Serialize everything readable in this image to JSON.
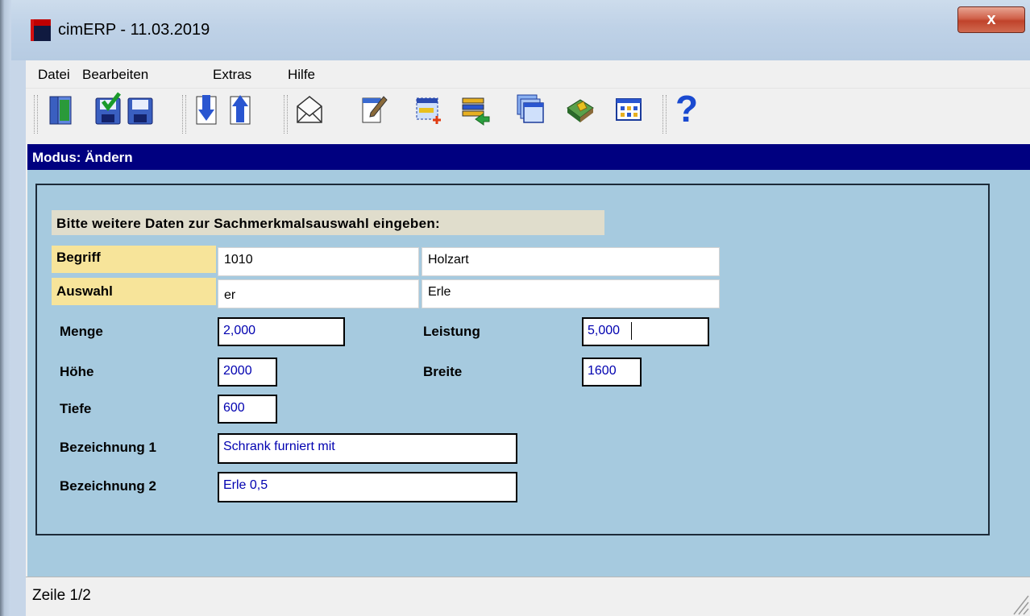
{
  "window": {
    "title": "cimERP - 11.03.2019",
    "close_label": "x"
  },
  "menu": {
    "items": [
      "Datei",
      "Bearbeiten",
      "Extras",
      "Hilfe"
    ]
  },
  "toolbar": {
    "icons": [
      "exit-door-icon",
      "save-check-icon",
      "save-icon",
      "arrow-down-icon",
      "arrow-up-icon",
      "envelope-icon",
      "edit-pen-icon",
      "new-table-icon",
      "import-list-icon",
      "windows-icon",
      "book-tag-icon",
      "grid-table-icon",
      "help-icon"
    ],
    "help_glyph": "?"
  },
  "mode": {
    "label": "Modus: Ändern"
  },
  "form": {
    "prompt": "Bitte weitere Daten zur Sachmerkmalsauswahl eingeben:",
    "begriff": {
      "label": "Begriff",
      "code": "1010",
      "desc": "Holzart"
    },
    "auswahl": {
      "label": "Auswahl",
      "code": "er",
      "desc": "Erle"
    },
    "menge": {
      "label": "Menge",
      "value": "2,000"
    },
    "leistung": {
      "label": "Leistung",
      "value": "5,000"
    },
    "hoehe": {
      "label": "Höhe",
      "value": "2000"
    },
    "breite": {
      "label": "Breite",
      "value": "1600"
    },
    "tiefe": {
      "label": "Tiefe",
      "value": "600"
    },
    "bez1": {
      "label": "Bezeichnung 1",
      "value": "Schrank furniert mit"
    },
    "bez2": {
      "label": "Bezeichnung 2",
      "value": "Erle 0,5"
    }
  },
  "status": {
    "text": "Zeile 1/2"
  },
  "colors": {
    "mode_bar": "#000080",
    "form_bg": "#a6cadf",
    "label_bg": "#f7e49a",
    "input_text": "#0000b0"
  }
}
